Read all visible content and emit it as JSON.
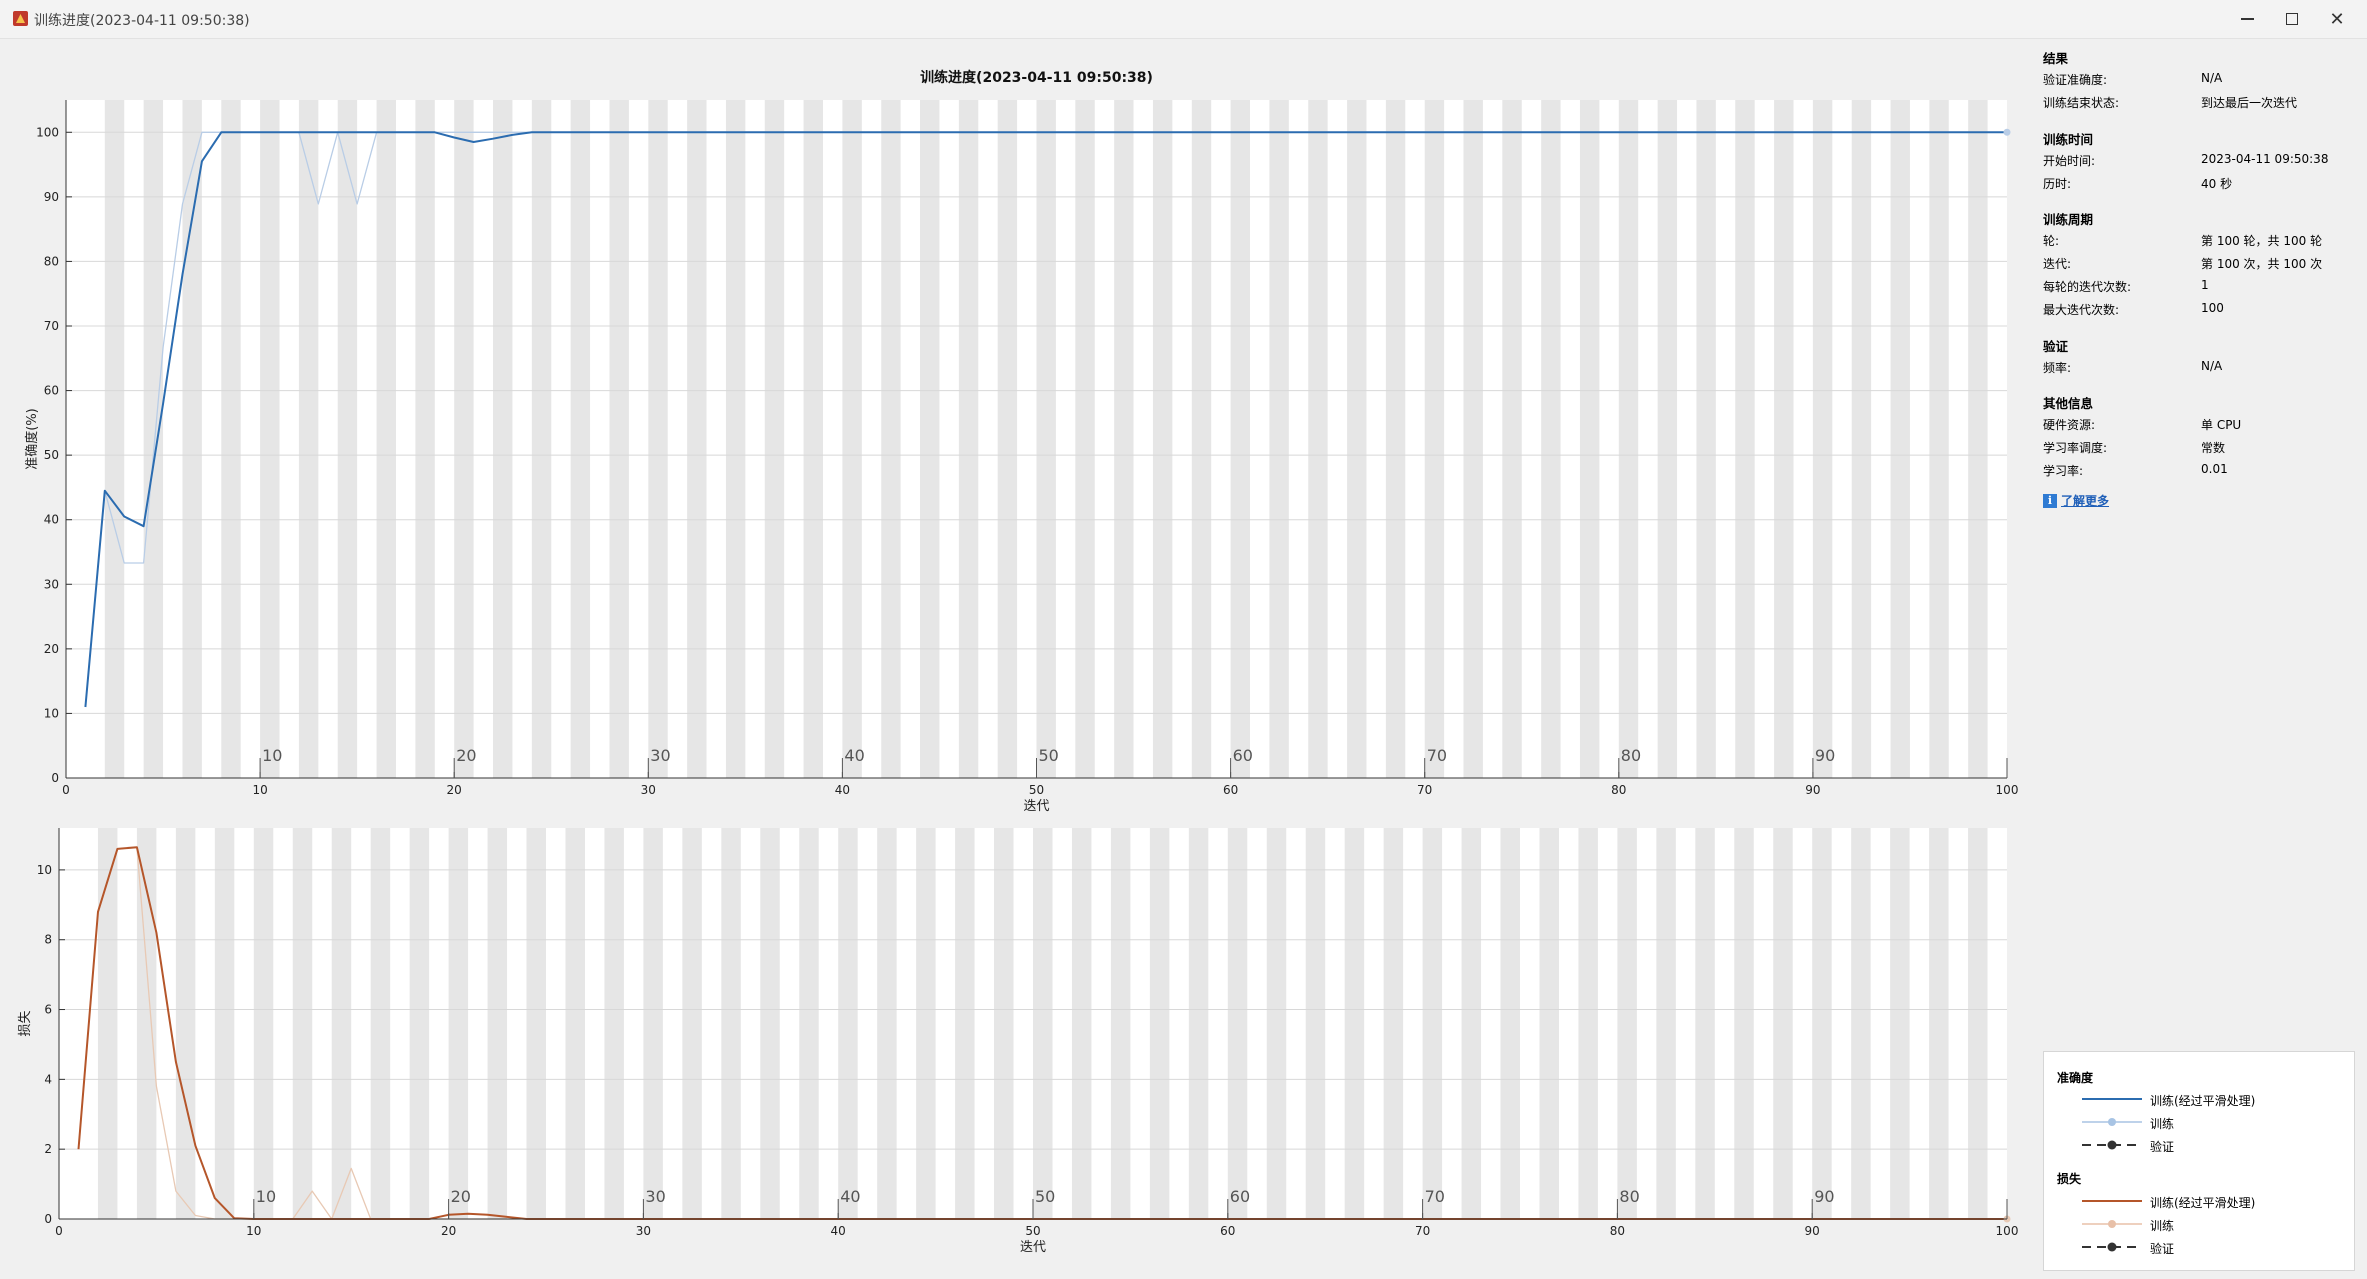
{
  "window": {
    "title": "训练进度(2023-04-11 09:50:38)",
    "minimize_glyph": "minimize-icon",
    "maximize_glyph": "maximize-icon",
    "close_glyph": "✕"
  },
  "chart_data": [
    {
      "type": "line",
      "title": "训练进度(2023-04-11 09:50:38)",
      "xlabel": "迭代",
      "ylabel": "准确度(%)",
      "xlim": [
        0,
        100
      ],
      "ylim": [
        0,
        105
      ],
      "xticks": [
        0,
        10,
        20,
        30,
        40,
        50,
        60,
        70,
        80,
        90,
        100
      ],
      "yticks": [
        0,
        10,
        20,
        30,
        40,
        50,
        60,
        70,
        80,
        90,
        100
      ],
      "epoch_labels": [
        "10",
        "20",
        "30",
        "40",
        "50",
        "60",
        "70",
        "80",
        "90"
      ],
      "grid": true,
      "series": [
        {
          "name": "训练(经过平滑处理)",
          "color": "#2b6cb0",
          "x": [
            1,
            2,
            3,
            4,
            5,
            6,
            7,
            8,
            9,
            10,
            15,
            19,
            20,
            21,
            22,
            23,
            24,
            30,
            40,
            50,
            60,
            70,
            80,
            90,
            100
          ],
          "values": [
            11,
            44.5,
            40.5,
            39,
            58,
            78,
            95.5,
            100,
            100,
            100,
            100,
            100,
            99.2,
            98.5,
            99,
            99.6,
            100,
            100,
            100,
            100,
            100,
            100,
            100,
            100,
            100
          ]
        },
        {
          "name": "训练",
          "color": "#b9cde6",
          "x": [
            1,
            2,
            3,
            4,
            5,
            6,
            7,
            8,
            9,
            10,
            11,
            12,
            13,
            14,
            15,
            16,
            17,
            18,
            19,
            20,
            25,
            30,
            40,
            50,
            60,
            70,
            80,
            90,
            100
          ],
          "values": [
            11,
            44.5,
            33.3,
            33.3,
            66.7,
            88.9,
            100,
            100,
            100,
            100,
            100,
            100,
            88.9,
            100,
            88.9,
            100,
            100,
            100,
            100,
            100,
            100,
            100,
            100,
            100,
            100,
            100,
            100,
            100,
            100
          ]
        }
      ]
    },
    {
      "type": "line",
      "title": "",
      "xlabel": "迭代",
      "ylabel": "损失",
      "xlim": [
        0,
        100
      ],
      "ylim": [
        0,
        11.2
      ],
      "xticks": [
        0,
        10,
        20,
        30,
        40,
        50,
        60,
        70,
        80,
        90,
        100
      ],
      "yticks": [
        0,
        2,
        4,
        6,
        8,
        10
      ],
      "epoch_labels": [
        "10",
        "20",
        "30",
        "40",
        "50",
        "60",
        "70",
        "80",
        "90"
      ],
      "grid": true,
      "series": [
        {
          "name": "训练(经过平滑处理)",
          "color": "#b5562a",
          "x": [
            1,
            2,
            3,
            4,
            5,
            6,
            7,
            8,
            9,
            10,
            15,
            19,
            20,
            21,
            22,
            23,
            24,
            30,
            40,
            50,
            60,
            70,
            80,
            90,
            100
          ],
          "values": [
            2,
            8.8,
            10.6,
            10.65,
            8.2,
            4.5,
            2.1,
            0.6,
            0.02,
            0,
            0,
            0,
            0.12,
            0.15,
            0.12,
            0.06,
            0,
            0,
            0,
            0,
            0,
            0,
            0,
            0,
            0
          ]
        },
        {
          "name": "训练",
          "color": "#e8c9b4",
          "x": [
            1,
            2,
            3,
            4,
            5,
            6,
            7,
            8,
            9,
            10,
            11,
            12,
            13,
            14,
            15,
            16,
            17,
            18,
            19,
            20,
            25,
            30,
            40,
            50,
            60,
            70,
            80,
            90,
            100
          ],
          "values": [
            2,
            8.8,
            10.6,
            10.65,
            3.8,
            0.8,
            0.1,
            0,
            0,
            0,
            0,
            0,
            0.8,
            0,
            1.45,
            0,
            0,
            0,
            0,
            0,
            0,
            0,
            0,
            0,
            0,
            0,
            0,
            0,
            0
          ]
        }
      ]
    }
  ],
  "info": {
    "results_header": "结果",
    "val_acc_label": "验证准确度:",
    "val_acc_value": "N/A",
    "status_label": "训练结束状态:",
    "status_value": "到达最后一次迭代",
    "time_header": "训练时间",
    "start_label": "开始时间:",
    "start_value": "2023-04-11 09:50:38",
    "elapsed_label": "历时:",
    "elapsed_value": "40 秒",
    "cycle_header": "训练周期",
    "epoch_label": "轮:",
    "epoch_value": "第 100 轮，共 100 轮",
    "iter_label": "迭代:",
    "iter_value": "第 100 次，共 100 次",
    "iter_per_epoch_label": "每轮的迭代次数:",
    "iter_per_epoch_value": "1",
    "max_iter_label": "最大迭代次数:",
    "max_iter_value": "100",
    "validation_header": "验证",
    "freq_label": "频率:",
    "freq_value": "N/A",
    "other_header": "其他信息",
    "hw_label": "硬件资源:",
    "hw_value": "单 CPU",
    "lr_sched_label": "学习率调度:",
    "lr_sched_value": "常数",
    "lr_label": "学习率:",
    "lr_value": "0.01",
    "info_icon": "i",
    "learn_more": "了解更多"
  },
  "legend": {
    "acc_header": "准确度",
    "acc_smoothed": "训练(经过平滑处理)",
    "acc_train": "训练",
    "acc_val": "验证",
    "loss_header": "损失",
    "loss_smoothed": "训练(经过平滑处理)",
    "loss_train": "训练",
    "loss_val": "验证",
    "acc_color": "#2b6cb0",
    "acc_light": "#a8c4e4",
    "loss_color": "#b5562a",
    "loss_light": "#e8c0a8",
    "val_color": "#333333"
  }
}
